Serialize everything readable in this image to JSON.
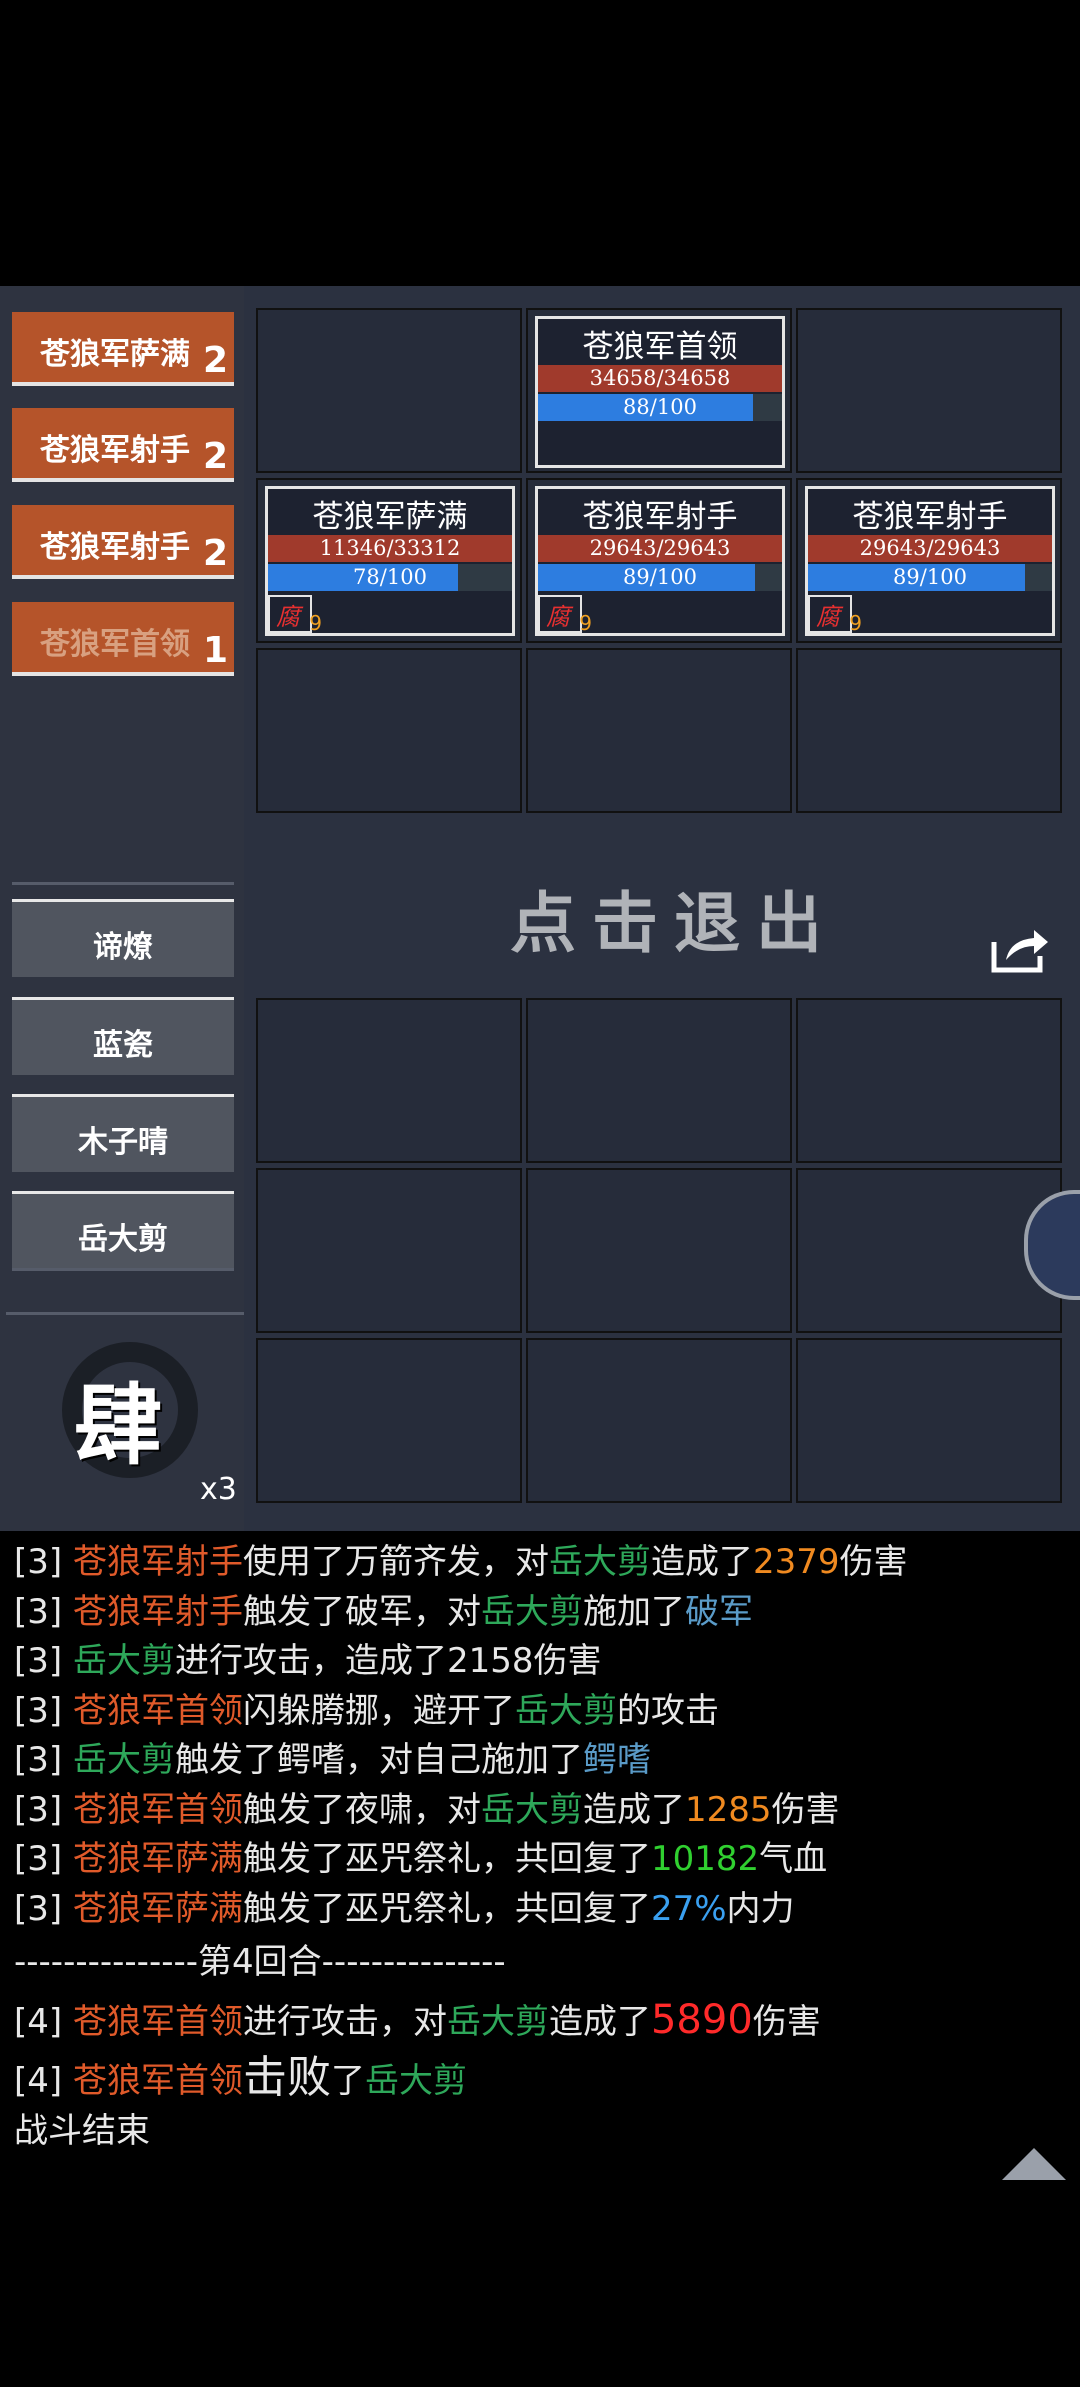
{
  "enemy_tabs": [
    {
      "name": "苍狼军萨满",
      "count": "2"
    },
    {
      "name": "苍狼军射手",
      "count": "2"
    },
    {
      "name": "苍狼军射手",
      "count": "2"
    },
    {
      "name": "苍狼军首领",
      "count": "1"
    }
  ],
  "party_tabs": [
    "谛燎",
    "蓝瓷",
    "木子晴",
    "岳大剪"
  ],
  "skill": {
    "glyph": "肆",
    "count": "x3"
  },
  "units": [
    {
      "name": "苍狼军首领",
      "hp": "34658/34658",
      "mp": "88/100",
      "mp_frac": 0.88
    },
    {
      "name": "苍狼军萨满",
      "hp": "11346/33312",
      "mp": "78/100",
      "mp_frac": 0.78,
      "buff": "腐",
      "buff_n": "9"
    },
    {
      "name": "苍狼军射手",
      "hp": "29643/29643",
      "mp": "89/100",
      "mp_frac": 0.89,
      "buff": "腐",
      "buff_n": "9"
    },
    {
      "name": "苍狼军射手",
      "hp": "29643/29643",
      "mp": "89/100",
      "mp_frac": 0.89,
      "buff": "腐",
      "buff_n": "9"
    }
  ],
  "exit_label": "点击退出",
  "log_lines": [
    [
      [
        "[3] ",
        ""
      ],
      [
        "苍狼军射手",
        "o"
      ],
      [
        "使用了万箭齐发，对",
        ""
      ],
      [
        "岳大剪",
        "g"
      ],
      [
        "造成了",
        ""
      ],
      [
        "2379",
        "y"
      ],
      [
        "伤害",
        ""
      ]
    ],
    [
      [
        "[3] ",
        ""
      ],
      [
        "苍狼军射手",
        "o"
      ],
      [
        "触发了破军，对",
        ""
      ],
      [
        "岳大剪",
        "g"
      ],
      [
        "施加了",
        ""
      ],
      [
        "破军",
        "t"
      ]
    ],
    [
      [
        "[3] ",
        ""
      ],
      [
        "岳大剪",
        "g"
      ],
      [
        "进行攻击，造成了2158伤害",
        ""
      ]
    ],
    [
      [
        "[3] ",
        ""
      ],
      [
        "苍狼军首领",
        "o"
      ],
      [
        "闪躲腾挪，避开了",
        ""
      ],
      [
        "岳大剪",
        "g"
      ],
      [
        "的攻击",
        ""
      ]
    ],
    [
      [
        "[3] ",
        ""
      ],
      [
        "岳大剪",
        "g"
      ],
      [
        "触发了鳄嗜，对自己施加了",
        ""
      ],
      [
        "鳄嗜",
        "t"
      ]
    ],
    [
      [
        "[3] ",
        ""
      ],
      [
        "苍狼军首领",
        "o"
      ],
      [
        "触发了夜啸，对",
        ""
      ],
      [
        "岳大剪",
        "g"
      ],
      [
        "造成了",
        ""
      ],
      [
        "1285",
        "y"
      ],
      [
        "伤害",
        ""
      ]
    ],
    [
      [
        "[3] ",
        ""
      ],
      [
        "苍狼军萨满",
        "o"
      ],
      [
        "触发了巫咒祭礼，共回复了",
        ""
      ],
      [
        "10182",
        "gr"
      ],
      [
        "气血",
        ""
      ]
    ],
    [
      [
        "[3] ",
        ""
      ],
      [
        "苍狼军萨满",
        "o"
      ],
      [
        "触发了巫咒祭礼，共回复了",
        ""
      ],
      [
        "27%",
        "b"
      ],
      [
        "内力",
        ""
      ]
    ],
    [
      [
        "---------------第4回合---------------",
        ""
      ]
    ],
    [
      [
        "[4] ",
        ""
      ],
      [
        "苍狼军首领",
        "o"
      ],
      [
        "进行攻击，对",
        ""
      ],
      [
        "岳大剪",
        "g"
      ],
      [
        "造成了",
        ""
      ],
      [
        "5890",
        "r"
      ],
      [
        "伤害",
        ""
      ]
    ],
    [
      [
        "[4] ",
        ""
      ],
      [
        "苍狼军首领",
        "o"
      ],
      [
        "击败",
        "big"
      ],
      [
        "了",
        ""
      ],
      [
        "岳大剪",
        "g"
      ]
    ],
    [
      [
        "战斗结束",
        ""
      ]
    ]
  ]
}
